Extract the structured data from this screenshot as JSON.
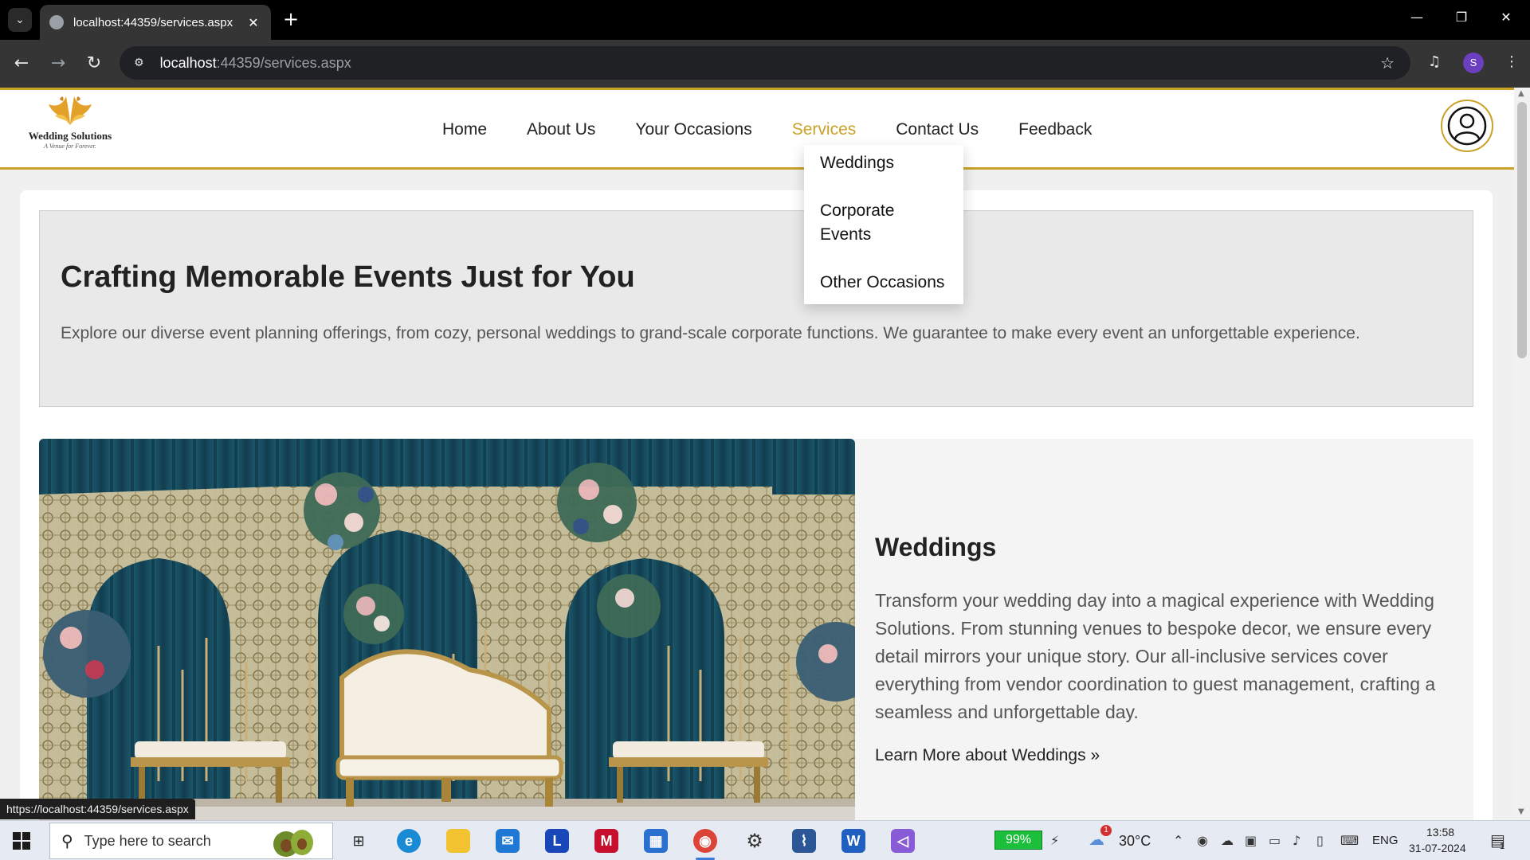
{
  "browser": {
    "tab_title": "localhost:44359/services.aspx",
    "url_host": "localhost",
    "url_rest": ":44359/services.aspx",
    "profile_initial": "S",
    "status_url": "https://localhost:44359/services.aspx"
  },
  "site": {
    "logo_name": "Wedding Solutions",
    "logo_tagline": "A Venue for Forever.",
    "nav": [
      {
        "label": "Home"
      },
      {
        "label": "About Us"
      },
      {
        "label": "Your Occasions"
      },
      {
        "label": "Services"
      },
      {
        "label": "Contact Us"
      },
      {
        "label": "Feedback"
      }
    ],
    "dropdown": [
      {
        "label": "Weddings"
      },
      {
        "label": "Corporate Events"
      },
      {
        "label": "Other Occasions"
      }
    ],
    "accent_color": "#c9a227"
  },
  "hero": {
    "title": "Crafting Memorable Events Just for You",
    "text": "Explore our diverse event planning offerings, from cozy, personal weddings to grand-scale corporate functions. We guarantee to make every event an unforgettable experience."
  },
  "service": {
    "title": "Weddings",
    "text": "Transform your wedding day into a magical experience with Wedding Solutions. From stunning venues to bespoke decor, we ensure every detail mirrors your unique story. Our all-inclusive services cover everything from vendor coordination to guest management, crafting a seamless and unforgettable day.",
    "link": "Learn More about Weddings »"
  },
  "taskbar": {
    "search_placeholder": "Type here to search",
    "battery": "99%",
    "weather": "30°C",
    "language": "ENG",
    "time": "13:58",
    "date": "31-07-2024",
    "notification_count": "1",
    "weather_alert": "1"
  }
}
